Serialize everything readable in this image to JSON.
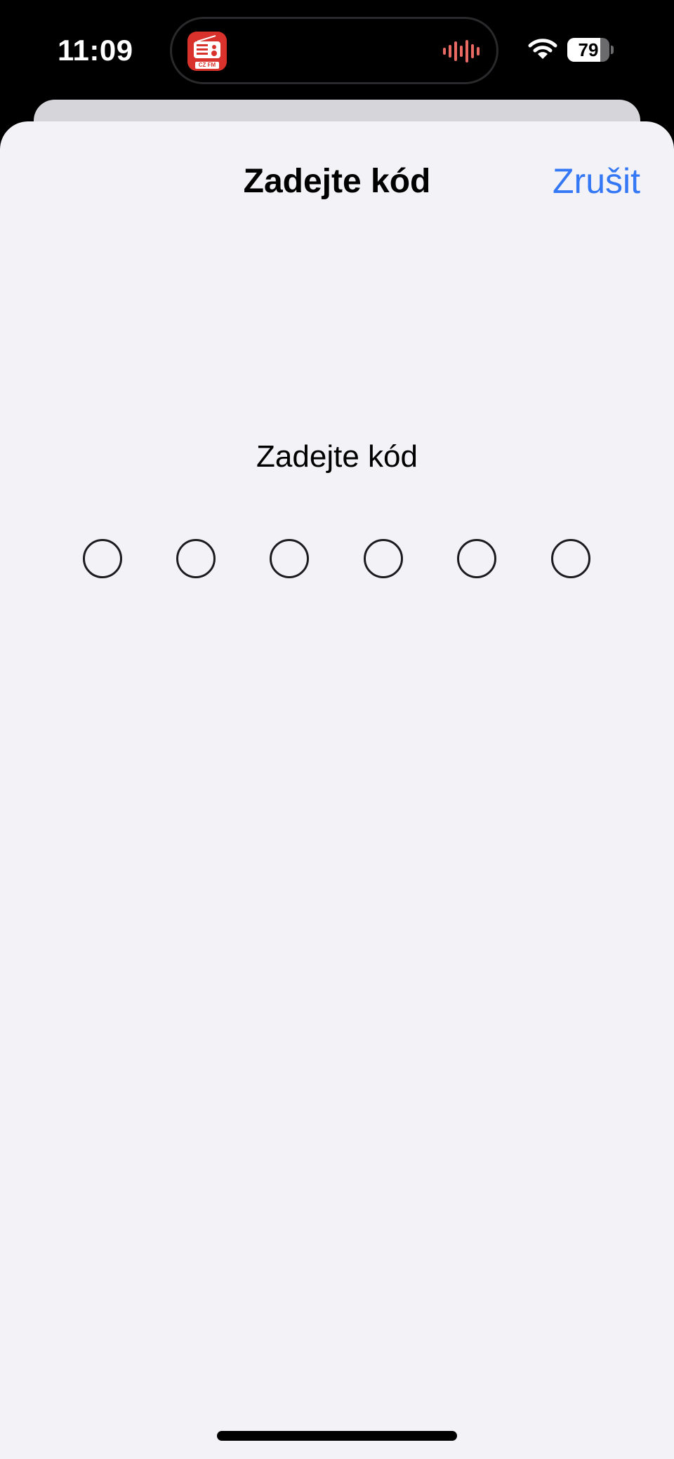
{
  "status_bar": {
    "time": "11:09",
    "battery_level": "79",
    "battery_fraction": 0.79,
    "wifi_icon": "wifi-icon",
    "live_activity": {
      "app_icon": "radio-app-icon",
      "app_caption": "CZ FM",
      "indicator_icon": "audio-waveform-icon",
      "indicator_color": "#e96a63"
    }
  },
  "sheet": {
    "title": "Zadejte kód",
    "cancel_label": "Zrušit",
    "prompt": "Zadejte kód",
    "code_length": 6,
    "digits_entered": 0
  },
  "colors": {
    "accent": "#3478f6",
    "sheet_background": "#f2f2f7",
    "app_icon_red": "#d9322d"
  }
}
